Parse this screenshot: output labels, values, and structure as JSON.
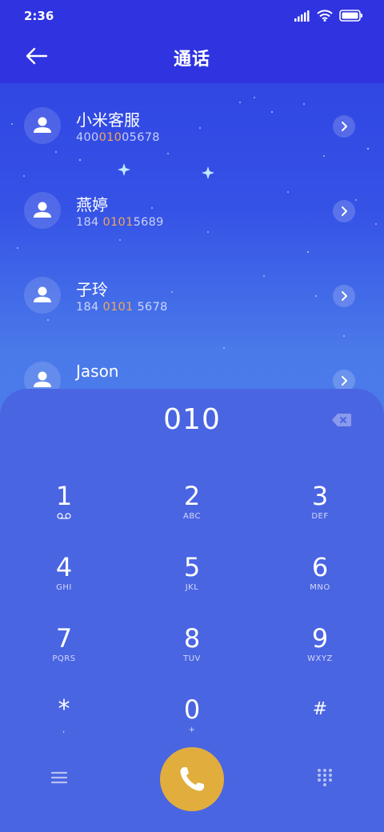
{
  "status_bar": {
    "time": "2:36"
  },
  "header": {
    "title": "通话"
  },
  "contacts": [
    {
      "name": "小米客服",
      "number_parts": [
        "400",
        "010",
        "05678"
      ]
    },
    {
      "name": "燕婷",
      "number_parts": [
        "184 ",
        "0101",
        "5689"
      ]
    },
    {
      "name": "子玲",
      "number_parts": [
        "184 ",
        "0101",
        " 5678"
      ]
    },
    {
      "name": "Jason",
      "number_parts": [
        "",
        "",
        ""
      ]
    }
  ],
  "dialpad": {
    "display": "010",
    "keys": [
      {
        "digit": "1",
        "letters": ""
      },
      {
        "digit": "2",
        "letters": "ABC"
      },
      {
        "digit": "3",
        "letters": "DEF"
      },
      {
        "digit": "4",
        "letters": "GHI"
      },
      {
        "digit": "5",
        "letters": "JKL"
      },
      {
        "digit": "6",
        "letters": "MNO"
      },
      {
        "digit": "7",
        "letters": "PQRS"
      },
      {
        "digit": "8",
        "letters": "TUV"
      },
      {
        "digit": "9",
        "letters": "WXYZ"
      },
      {
        "digit": "*",
        "letters": ","
      },
      {
        "digit": "0",
        "letters": "+"
      },
      {
        "digit": "#",
        "letters": ""
      }
    ]
  },
  "colors": {
    "header_bg": "#2f33e0",
    "dialpad_bg": "#4a65e2",
    "highlight": "#f3a75a",
    "call_button": "#e1ad3c"
  }
}
